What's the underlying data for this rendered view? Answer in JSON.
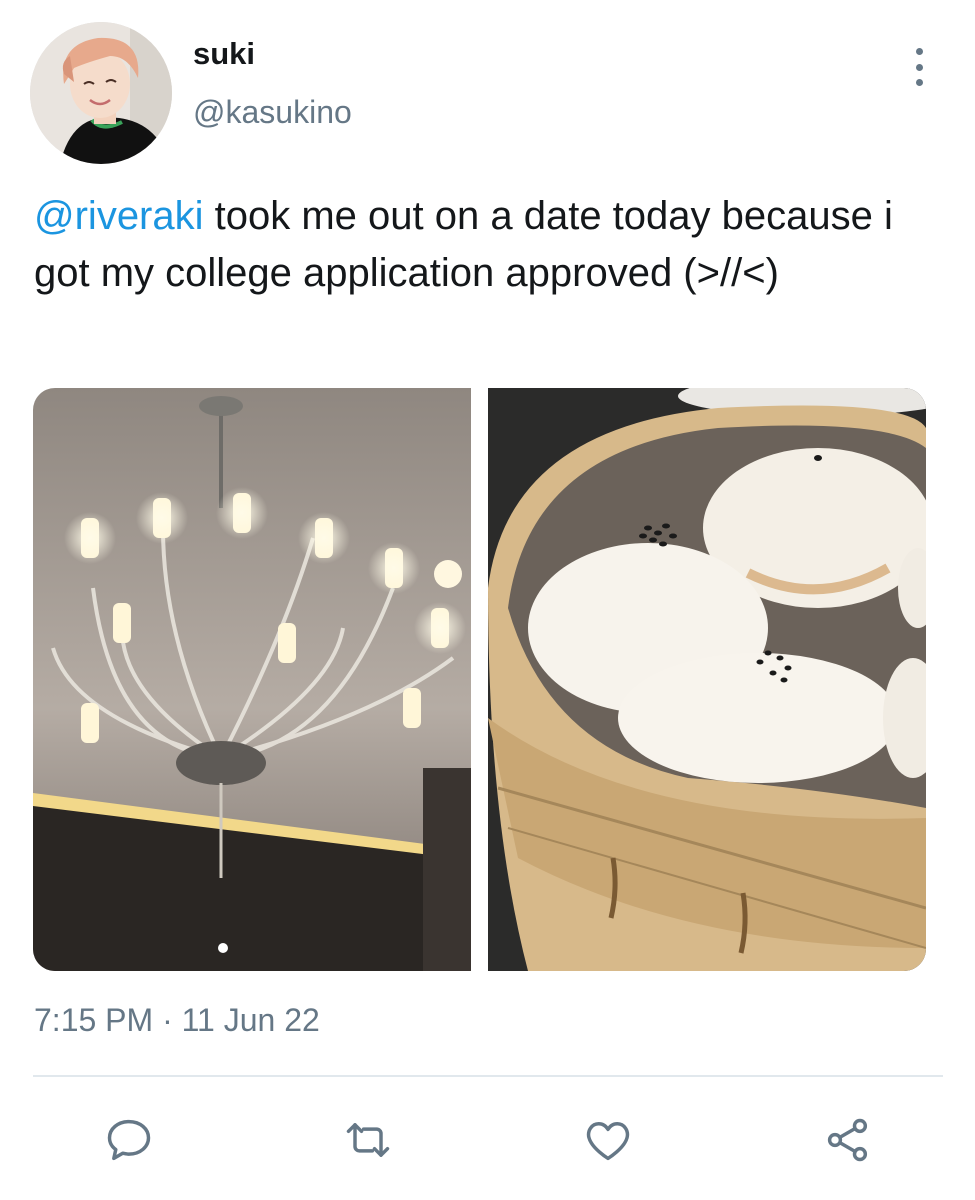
{
  "user": {
    "display_name": "suki",
    "handle": "@kasukino"
  },
  "tweet": {
    "mention": "@riveraki",
    "text": " took me out on a date today because i got my college application approved (>//<)",
    "timestamp": "7:15 PM · 11 Jun 22"
  },
  "media": [
    {
      "subject": "crystal chandelier"
    },
    {
      "subject": "steamed buns in bamboo steamer"
    }
  ],
  "actions": {
    "reply_icon": "speech-bubble",
    "retweet_icon": "retweet-arrows",
    "like_icon": "heart",
    "share_icon": "share-nodes"
  },
  "colors": {
    "link": "#1b95e0",
    "secondary_text": "#657786",
    "primary_text": "#14171a",
    "divider": "#e1e8ed"
  }
}
